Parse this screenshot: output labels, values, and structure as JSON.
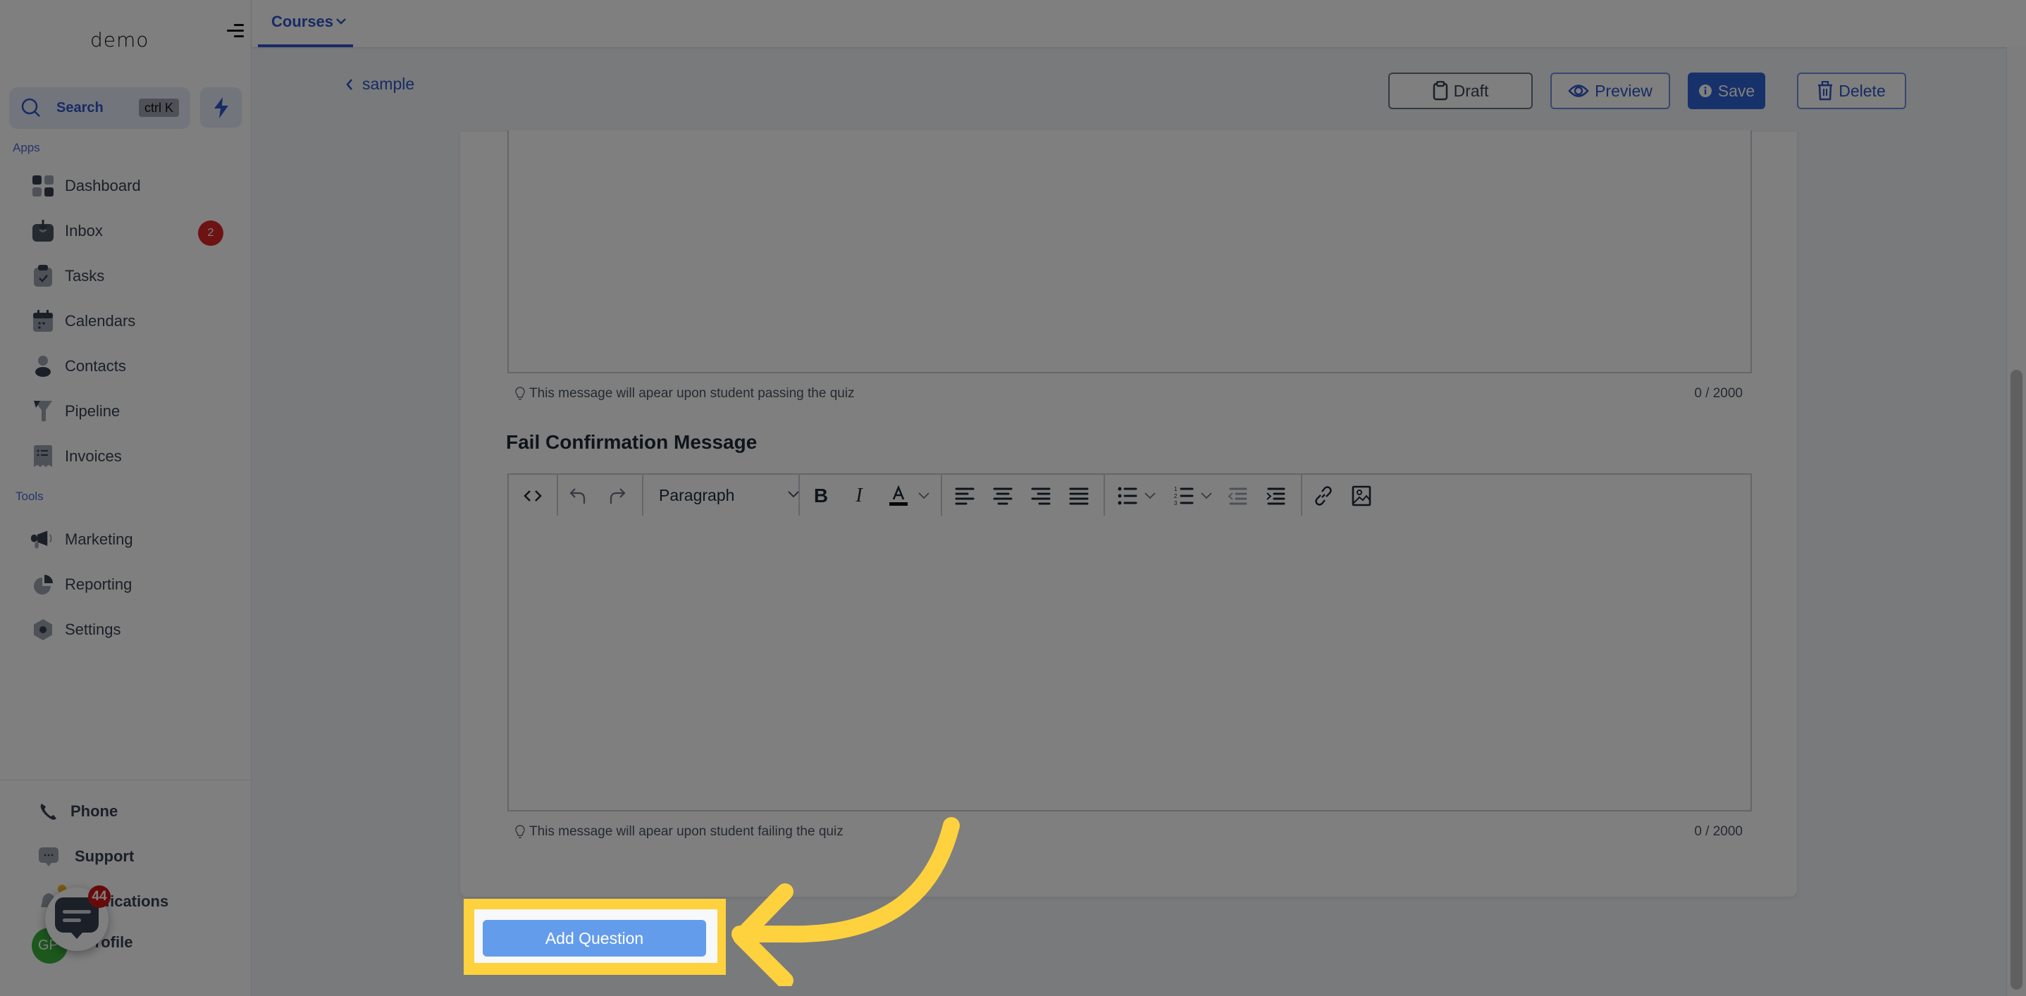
{
  "brand": {
    "logo_text": "demo"
  },
  "sidebar": {
    "search": {
      "label": "Search",
      "shortcut": "ctrl K"
    },
    "sections": {
      "apps_label": "Apps",
      "tools_label": "Tools"
    },
    "apps": [
      {
        "label": "Dashboard",
        "icon": "dashboard-icon"
      },
      {
        "label": "Inbox",
        "icon": "inbox-icon",
        "badge": "2"
      },
      {
        "label": "Tasks",
        "icon": "tasks-icon"
      },
      {
        "label": "Calendars",
        "icon": "calendar-icon"
      },
      {
        "label": "Contacts",
        "icon": "contacts-icon"
      },
      {
        "label": "Pipeline",
        "icon": "pipeline-icon"
      },
      {
        "label": "Invoices",
        "icon": "invoices-icon"
      }
    ],
    "tools": [
      {
        "label": "Marketing",
        "icon": "megaphone-icon"
      },
      {
        "label": "Reporting",
        "icon": "pie-chart-icon"
      },
      {
        "label": "Settings",
        "icon": "gear-icon"
      }
    ],
    "bottom": [
      {
        "label": "Phone",
        "icon": "phone-icon"
      },
      {
        "label": "Support",
        "icon": "chat-bubble-icon"
      },
      {
        "label": "Notifications",
        "icon": "bell-icon"
      },
      {
        "label": "Profile",
        "icon": "avatar"
      }
    ],
    "avatar_initials": "GP",
    "chat_widget_badge": "44"
  },
  "topbar": {
    "tabs": [
      {
        "label": "Courses",
        "active": true
      }
    ]
  },
  "page_header": {
    "back_label": "sample",
    "buttons": {
      "draft": "Draft",
      "preview": "Preview",
      "save": "Save",
      "delete": "Delete"
    }
  },
  "quiz_settings": {
    "pass_message": {
      "hint": "This message will apear upon student passing the quiz",
      "counter": "0 / 2000",
      "value": ""
    },
    "fail_message": {
      "title": "Fail Confirmation Message",
      "block_format": "Paragraph",
      "hint": "This message will apear upon student failing the quiz",
      "counter": "0 / 2000",
      "value": ""
    }
  },
  "actions": {
    "add_question": "Add Question"
  },
  "colors": {
    "primary": "#2f56c8",
    "save_button": "#2f62d6",
    "add_question_button": "#649cec",
    "highlight": "#fed13f",
    "badge": "#dc2626"
  }
}
